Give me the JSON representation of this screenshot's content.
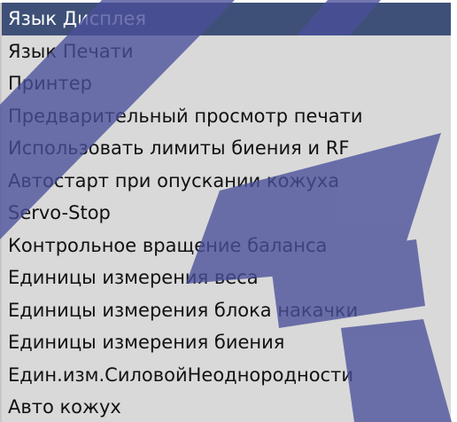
{
  "menu": {
    "selected_index": 0,
    "items": [
      {
        "label": "Язык Дисплея"
      },
      {
        "label": "Язык Печати"
      },
      {
        "label": "Принтер"
      },
      {
        "label": "Предварительный просмотр печати"
      },
      {
        "label": "Использовать лимиты биения и RF"
      },
      {
        "label": "Автостарт при опускании кожуха"
      },
      {
        "label": "Servo-Stop"
      },
      {
        "label": "Контрольное вращение баланса"
      },
      {
        "label": "Единицы измерения веса"
      },
      {
        "label": "Единицы измерения блока накачки"
      },
      {
        "label": "Единицы измерения биения"
      },
      {
        "label": "Един.изм.СиловойНеоднородности"
      },
      {
        "label": "Авто кожух"
      }
    ]
  },
  "colors": {
    "background": "#d9d9d9",
    "selected_background": "#3e5077",
    "selected_text": "#ffffff",
    "text": "#111111",
    "watermark": "#4a4f9a"
  }
}
